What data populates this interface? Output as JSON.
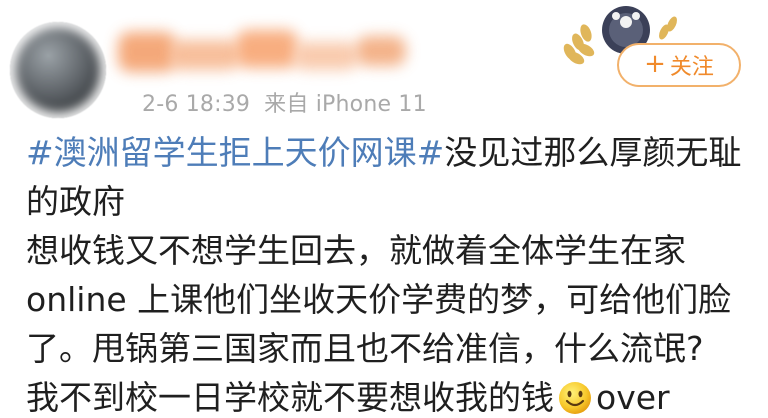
{
  "header": {
    "timestamp": "2-6 18:39",
    "source": "来自 iPhone 11",
    "follow_label": "关注",
    "follow_icon": "plus-icon"
  },
  "post": {
    "hashtag": "#澳洲留学生拒上天价网课#",
    "line1_rest": "没见过那么厚颜无耻",
    "line2": "的政府",
    "line3": "想收钱又不想学生回去，就做着全体学生在家",
    "line4": "online 上课他们坐收天价学费的梦，可给他们脸",
    "line5": "了。甩锅第三国家而且也不给准信，什么流氓?",
    "line6_before": "我不到校一日学校就不要想收我的钱",
    "line6_emoji": "smile-emoji",
    "line6_after": "over"
  },
  "colors": {
    "hashtag": "#4e7db8",
    "follow_accent": "#f08a2b",
    "follow_border": "#f2b16b",
    "meta_text": "#a9a9a9",
    "body_text": "#1f1f1f"
  }
}
